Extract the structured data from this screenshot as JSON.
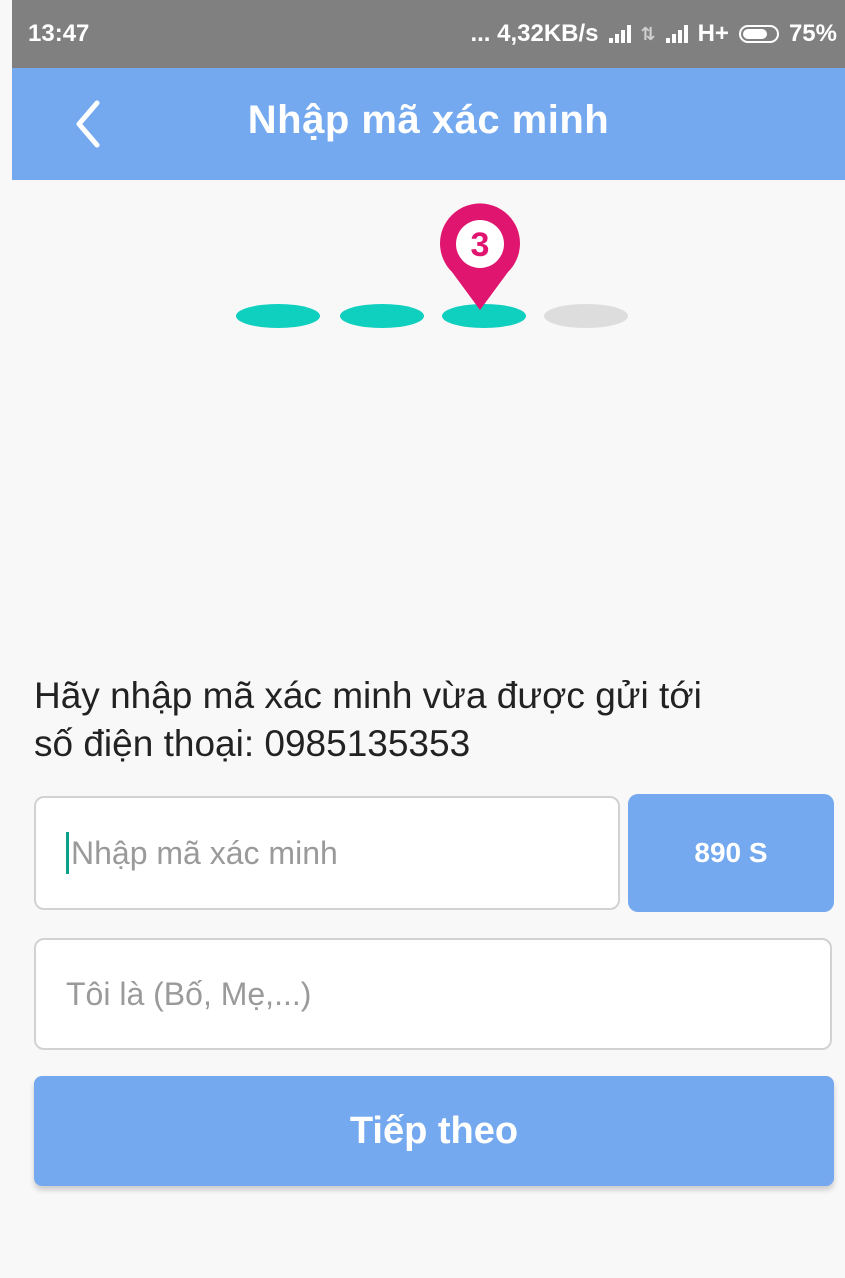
{
  "status_bar": {
    "time": "13:47",
    "network_speed": "... 4,32KB/s",
    "network_type": "H+",
    "battery_percent": "75%",
    "battery_level": 0.75,
    "icons": [
      "signal-icon",
      "data-arrows-icon",
      "signal-icon",
      "battery-icon"
    ]
  },
  "header": {
    "title": "Nhập mã xác minh",
    "back_icon": "chevron-left-icon"
  },
  "stepper": {
    "current_step_label": "3",
    "total_steps": 4,
    "current_step": 3,
    "active_color": "#0fcfbf",
    "inactive_color": "#dddddd",
    "pin_color": "#e0156f"
  },
  "instructions": {
    "line1": "Hãy nhập mã xác minh vừa được gửi tới",
    "line2": "số điện thoại: 0985135353"
  },
  "form": {
    "code_placeholder": "Nhập mã xác minh",
    "code_value": "",
    "timer_label": "890 S",
    "role_placeholder": "Tôi là (Bố, Mẹ,...)",
    "role_value": "",
    "next_label": "Tiếp theo"
  },
  "colors": {
    "accent": "#74a9f0",
    "status_bar": "#808080",
    "background": "#f8f8f8"
  }
}
